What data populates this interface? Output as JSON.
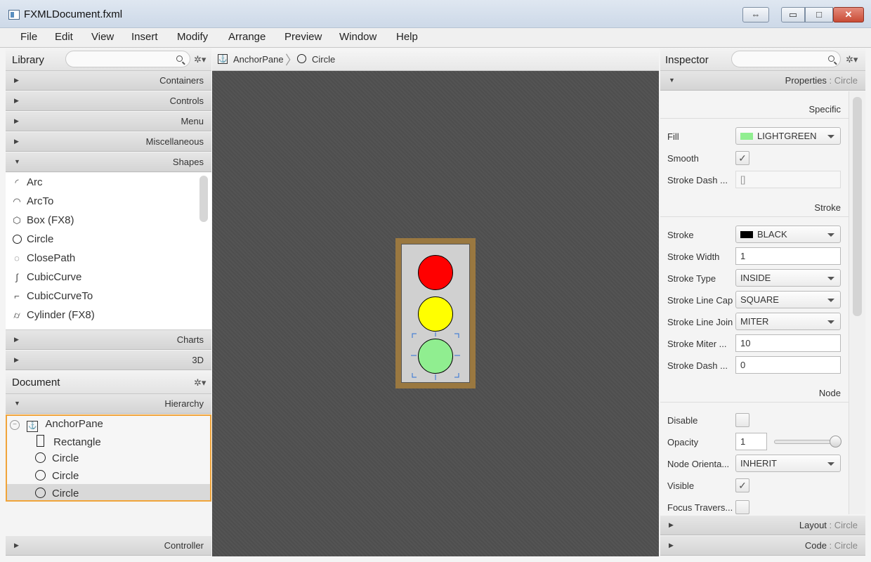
{
  "window": {
    "title": "FXMLDocument.fxml",
    "buttons": {
      "restore": "⇔",
      "minimize": "▭",
      "maximize": "□",
      "close": "✕"
    }
  },
  "menu": [
    "File",
    "Edit",
    "View",
    "Insert",
    "Modify",
    "Arrange",
    "Preview",
    "Window",
    "Help"
  ],
  "library": {
    "title": "Library",
    "sections": {
      "containers": "Containers",
      "controls": "Controls",
      "menu": "Menu",
      "misc": "Miscellaneous",
      "shapes": "Shapes",
      "charts": "Charts",
      "threed": "3D"
    },
    "shapes": [
      {
        "label": "Arc",
        "icon": "arc-icon"
      },
      {
        "label": "ArcTo",
        "icon": "arcto-icon"
      },
      {
        "label": "Box  (FX8)",
        "icon": "box-icon"
      },
      {
        "label": "Circle",
        "icon": "circle-icon"
      },
      {
        "label": "ClosePath",
        "icon": "closepath-icon"
      },
      {
        "label": "CubicCurve",
        "icon": "cubiccurve-icon"
      },
      {
        "label": "CubicCurveTo",
        "icon": "cubiccurveto-icon"
      },
      {
        "label": "Cylinder  (FX8)",
        "icon": "cylinder-icon"
      }
    ]
  },
  "breadcrumb": [
    "AnchorPane",
    "Circle"
  ],
  "document": {
    "title": "Document",
    "hierarchy_label": "Hierarchy",
    "controller_label": "Controller",
    "tree": [
      "AnchorPane",
      "Rectangle",
      "Circle",
      "Circle",
      "Circle"
    ]
  },
  "canvas": {
    "frame_color": "#9a7840",
    "panel_color": "#d0d0d0",
    "lights": [
      "#ff0000",
      "#ffff00",
      "#90ee90"
    ]
  },
  "inspector": {
    "title": "Inspector",
    "properties_header": "Properties",
    "properties_sub": ": Circle",
    "specific_label": "Specific",
    "stroke_label": "Stroke",
    "node_label": "Node",
    "fill_label": "Fill",
    "fill_value": "LIGHTGREEN",
    "fill_color": "#90ee90",
    "smooth_label": "Smooth",
    "stroke_dash_label_1": "Stroke Dash ...",
    "stroke_dash_value_1": "[]",
    "stroke_prop_label": "Stroke",
    "stroke_value": "BLACK",
    "stroke_color": "#000000",
    "stroke_width_label": "Stroke Width",
    "stroke_width_value": "1",
    "stroke_type_label": "Stroke Type",
    "stroke_type_value": "INSIDE",
    "stroke_line_cap_label": "Stroke Line Cap",
    "stroke_line_cap_value": "SQUARE",
    "stroke_line_join_label": "Stroke Line Join",
    "stroke_line_join_value": "MITER",
    "stroke_miter_label": "Stroke Miter ...",
    "stroke_miter_value": "10",
    "stroke_dash_label_2": "Stroke Dash ...",
    "stroke_dash_value_2": "0",
    "disable_label": "Disable",
    "opacity_label": "Opacity",
    "opacity_value": "1",
    "opacity_slider_fraction": 1.0,
    "node_orientation_label": "Node Orienta...",
    "node_orientation_value": "INHERIT",
    "visible_label": "Visible",
    "focus_label": "Focus Travers...",
    "layout_header": "Layout",
    "layout_sub": ": Circle",
    "code_header": "Code",
    "code_sub": ": Circle"
  }
}
